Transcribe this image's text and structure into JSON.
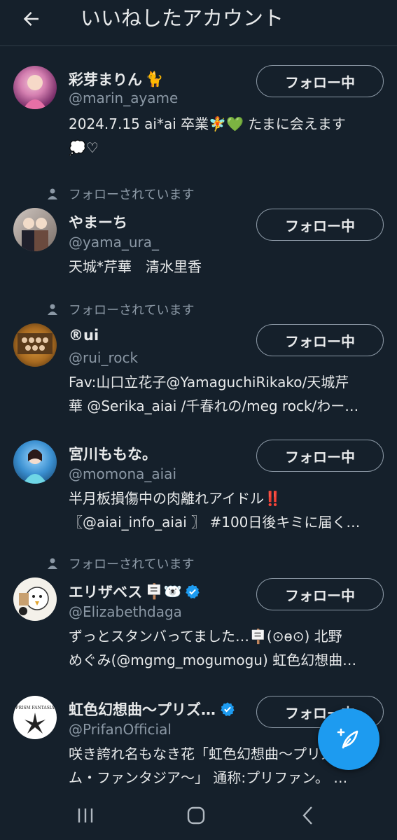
{
  "header": {
    "title": "いいねしたアカウント"
  },
  "users": [
    {
      "followsYou": "",
      "name": "彩芽まりん",
      "nameEmoji": "🐈",
      "handle": "@marin_ayame",
      "bio": [
        "2024.7.15 ai*ai 卒業🧚💚 たまに会えます",
        "💭♡"
      ],
      "button": "フォロー中",
      "verified": false
    },
    {
      "followsYou": "フォローされています",
      "name": "やまーち",
      "nameEmoji": "",
      "handle": "@yama_ura_",
      "bio": [
        "天城*芹華　清水里香"
      ],
      "button": "フォロー中",
      "verified": false
    },
    {
      "followsYou": "フォローされています",
      "name": "®ui",
      "nameEmoji": "",
      "handle": "@rui_rock",
      "bio": [
        "Fav:山口立花子@YamaguchiRikako/天城芹",
        "華 @Serika_aiai /千春れの/meg rock/わー…"
      ],
      "button": "フォロー中",
      "verified": false
    },
    {
      "followsYou": "",
      "name": "宮川ももな。",
      "nameEmoji": "",
      "handle": "@momona_aiai",
      "bio": [
        "半月板損傷中の肉離れアイドル‼️",
        "〖@aiai_info_aiai 〗 #100日後キミに届く…"
      ],
      "button": "フォロー中",
      "verified": false
    },
    {
      "followsYou": "フォローされています",
      "name": "エリザベス",
      "nameEmoji": "🪧🐻‍❄️",
      "handle": "@Elizabethdaga",
      "bio": [
        "ずっとスタンバってました…🪧(⊙ө⊙) 北野",
        "めぐみ(@mgmg_mogumogu) 虹色幻想曲…"
      ],
      "button": "フォロー中",
      "verified": true
    },
    {
      "followsYou": "",
      "name": "虹色幻想曲〜プリズ…",
      "nameEmoji": "",
      "handle": "@PrifanOfficial",
      "bio": [
        "咲き誇れ名もなき花「虹色幻想曲〜プリズ",
        "ム・ファンタジア〜」 通称:プリファン。 …"
      ],
      "button": "フォロー中",
      "verified": true,
      "avatarText": "PRISM FANTASIA"
    }
  ],
  "colors": {
    "background": "#15202b",
    "text": "#e7e9ea",
    "secondary": "#8b98a5",
    "accent": "#1d9bf0"
  },
  "icons": {
    "back": "arrow-left-icon",
    "followsYou": "person-icon",
    "verified": "verified-badge-icon",
    "fab": "compose-post-icon",
    "navRecents": "recents-icon",
    "navHome": "home-icon",
    "navBack": "back-chevron-icon"
  }
}
